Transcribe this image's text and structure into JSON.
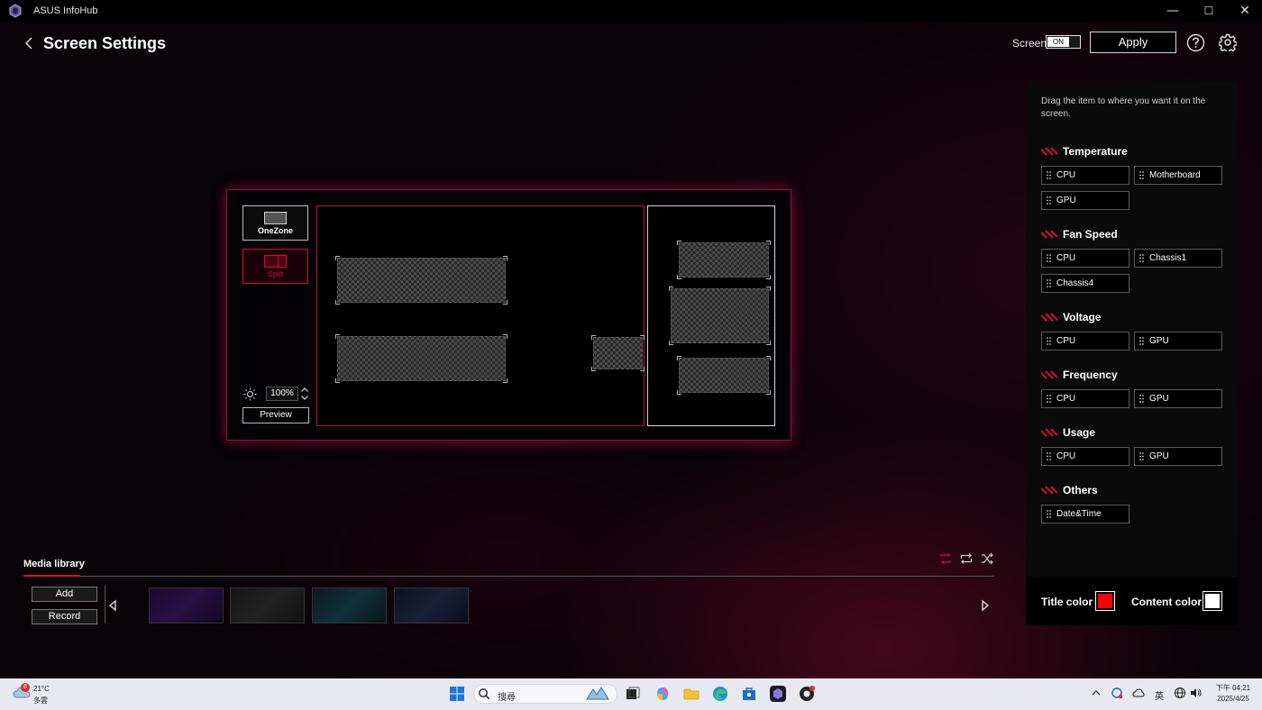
{
  "window": {
    "title": "ASUS InfoHub",
    "controls": [
      "—",
      "☐",
      "✕"
    ]
  },
  "header": {
    "title": "Screen Settings",
    "screen_label": "Screen",
    "toggle_state": "ON",
    "apply_label": "Apply"
  },
  "layout_modes": [
    {
      "label": "OneZone"
    },
    {
      "label": "Split"
    }
  ],
  "brightness": {
    "value": "100%"
  },
  "preview_label": "Preview",
  "panel": {
    "hint": "Drag the item to where you want it on the screen.",
    "sections": [
      {
        "title": "Temperature",
        "items": [
          "CPU",
          "Motherboard",
          "GPU"
        ]
      },
      {
        "title": "Fan Speed",
        "items": [
          "CPU",
          "Chassis1",
          "Chassis4"
        ]
      },
      {
        "title": "Voltage",
        "items": [
          "CPU",
          "GPU"
        ]
      },
      {
        "title": "Frequency",
        "items": [
          "CPU",
          "GPU"
        ]
      },
      {
        "title": "Usage",
        "items": [
          "CPU",
          "GPU"
        ]
      },
      {
        "title": "Others",
        "items": [
          "Date&Time"
        ]
      }
    ],
    "title_color_label": "Title color",
    "content_color_label": "Content color",
    "title_color": "#ff0000",
    "content_color": "#ffffff"
  },
  "media": {
    "tab_label": "Media library",
    "add_label": "Add",
    "record_label": "Record"
  },
  "taskbar": {
    "weather_badge": "8",
    "temperature": "21°C",
    "weather_desc": "多雲",
    "search_placeholder": "搜尋",
    "ime_label": "英",
    "clock_time": "下午 04:21",
    "clock_date": "2025/4/25"
  },
  "colors": {
    "accent": "#d0103c"
  }
}
